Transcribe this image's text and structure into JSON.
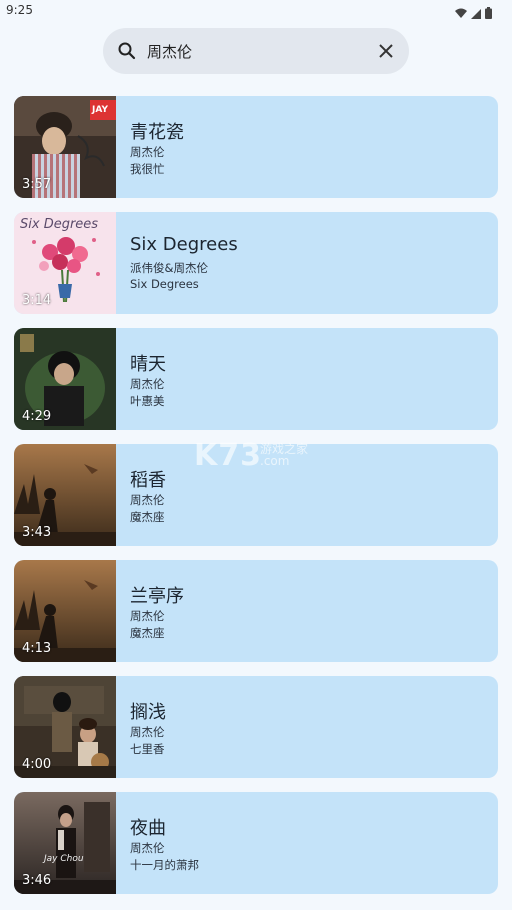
{
  "status_bar": {
    "time": "9:25",
    "icons": [
      "wifi-icon",
      "cell-signal-icon",
      "battery-icon"
    ]
  },
  "search": {
    "query": "周杰伦",
    "icon": "search-icon",
    "clear_icon": "close-icon"
  },
  "songs": [
    {
      "title": "青花瓷",
      "artist": "周杰伦",
      "album": "我很忙",
      "duration": "3:57"
    },
    {
      "title": "Six Degrees",
      "artist": "派伟俊&周杰伦",
      "album": "Six Degrees",
      "duration": "3:14"
    },
    {
      "title": "晴天",
      "artist": "周杰伦",
      "album": "叶惠美",
      "duration": "4:29"
    },
    {
      "title": "稻香",
      "artist": "周杰伦",
      "album": "魔杰座",
      "duration": "3:43"
    },
    {
      "title": "兰亭序",
      "artist": "周杰伦",
      "album": "魔杰座",
      "duration": "4:13"
    },
    {
      "title": "搁浅",
      "artist": "周杰伦",
      "album": "七里香",
      "duration": "4:00"
    },
    {
      "title": "夜曲",
      "artist": "周杰伦",
      "album": "十一月的萧邦",
      "duration": "3:46"
    }
  ],
  "cover_art": {
    "jay_logo": "JAY",
    "six_degrees_art": "Six Degrees",
    "shadow_wordmark": "Jay Chou"
  },
  "watermark": {
    "logo": "K73",
    "sub1": "游戏之家",
    "sub2": ".com"
  },
  "colors": {
    "background": "#f3f8fd",
    "card": "#c4e3f9",
    "search_bg": "#e2e7ee"
  }
}
